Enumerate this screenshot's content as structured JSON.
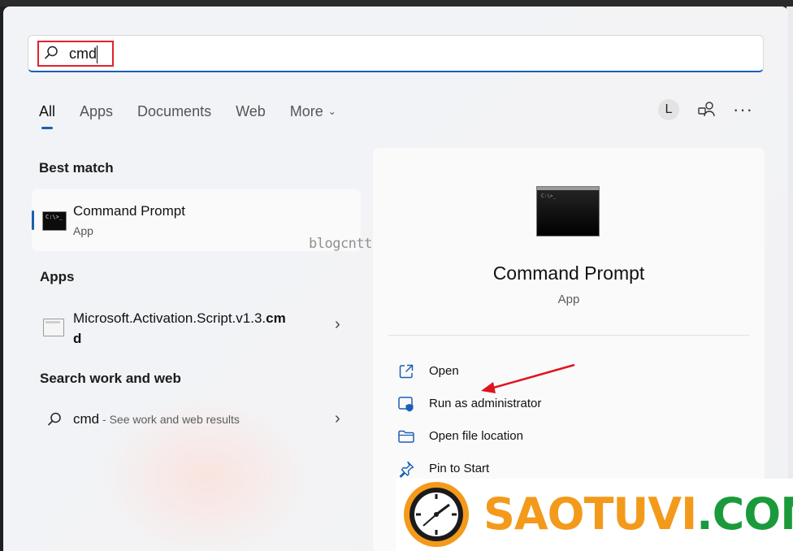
{
  "search": {
    "value": "cmd",
    "placeholder": ""
  },
  "tabs": [
    {
      "label": "All"
    },
    {
      "label": "Apps"
    },
    {
      "label": "Documents"
    },
    {
      "label": "Web"
    },
    {
      "label": "More"
    }
  ],
  "account": {
    "initial": "L"
  },
  "sections": {
    "best_match": "Best match",
    "apps": "Apps",
    "search_web": "Search work and web"
  },
  "best_match": {
    "title": "Command Prompt",
    "subtitle": "App"
  },
  "apps": [
    {
      "title_prefix": "Microsoft.Activation.Script.v1.3.",
      "title_bold": "cmd"
    }
  ],
  "web_result": {
    "query": "cmd",
    "suffix": " - See work and web results"
  },
  "detail": {
    "title": "Command Prompt",
    "subtitle": "App",
    "actions": [
      {
        "label": "Open",
        "icon": "open-external-icon"
      },
      {
        "label": "Run as administrator",
        "icon": "shield-admin-icon"
      },
      {
        "label": "Open file location",
        "icon": "folder-icon"
      },
      {
        "label": "Pin to Start",
        "icon": "pin-icon"
      }
    ]
  },
  "watermark": "blogcntt.com",
  "logo": {
    "part1": "SAOTUVI",
    "part2": ".COM"
  },
  "colors": {
    "accent": "#1a5fb4",
    "highlight": "#e0232d",
    "logo_orange": "#f39a1b",
    "logo_green": "#1a9a3a"
  }
}
